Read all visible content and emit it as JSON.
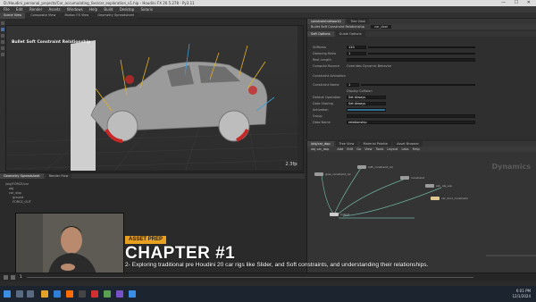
{
  "window": {
    "title": "D:/Houdini_personal_projects/Car_accumulating_live/car_exploration_v1.hip - Houdini FX 20.5.278 - Py3.11",
    "controls": "— ☐ ✕"
  },
  "menu": [
    "File",
    "Edit",
    "Render",
    "Assets",
    "Windows",
    "Help",
    "Build",
    "Desktop",
    "Solaris"
  ],
  "desktop_label": "Build",
  "viewport": {
    "tabs": [
      "Scene View",
      "Composite View",
      "Motion FX View",
      "Geometry Spreadsheet"
    ],
    "title": "Bullet Soft Constraint Relationship",
    "fps": "2.3fps"
  },
  "params": {
    "tabs": [
      "constraintnetwork1",
      "Tree View"
    ],
    "node_type": "Bullet Soft Constraint Relationship",
    "node_name": "car_door",
    "sub_tabs": [
      "Soft Options",
      "Guide Options"
    ],
    "rows": [
      {
        "label": "Stiffness",
        "value": "120"
      },
      {
        "label": "Damping Ratio",
        "value": "1"
      },
      {
        "label": "Rest Length",
        "value": ""
      },
      {
        "label": "Compute Bounce",
        "value": ""
      },
      {
        "label": "Constraint Name",
        "value": "1"
      },
      {
        "label": "Display Collision",
        "value": ""
      },
      {
        "label": "Default Operation",
        "value": "Set Always"
      },
      {
        "label": "Data Sharing",
        "value": "Set Always"
      },
      {
        "label": "Activation",
        "value": ""
      },
      {
        "label": "Group",
        "value": ""
      },
      {
        "label": "Data Name",
        "value": "relationship"
      }
    ],
    "checkbox_label": "Constraint Activation",
    "options_label": "Overrides Dynamic Behavior"
  },
  "network": {
    "tabs": [
      "/obj/car_dop",
      "Tree View",
      "Material Palette",
      "Asset Browser"
    ],
    "path": "obj   car_dop",
    "menu": [
      "Add",
      "Edit",
      "Go",
      "View",
      "Tools",
      "Layout",
      "Labs",
      "Help"
    ],
    "watermark": "Dynamics",
    "nodes": [
      "glue_constraint_rel",
      "soft_constraint_rel",
      "constraint",
      "sim_obj_sop",
      "output",
      "car_door_constraint"
    ]
  },
  "lower_left": {
    "tabs": [
      "Geometry Spreadsheet",
      "Render Flow"
    ],
    "tree": [
      "/obj/FORCE/car",
      "obj",
      "car_dop",
      "ground",
      "FORCE_OUT"
    ]
  },
  "timeline": {
    "frame": "1"
  },
  "overlay": {
    "tag": "ASSET PREP",
    "title": "CHAPTER #1",
    "subtitle": "2- Exploring traditional pre Houdini 20 car rigs like Slider, and Soft constraints, and understanding their relationships."
  },
  "taskbar": {
    "time": "6:01 PM",
    "date": "12/1/2024"
  },
  "colors": {
    "accent": "#e8a020",
    "taskbar": "#1c2430"
  }
}
